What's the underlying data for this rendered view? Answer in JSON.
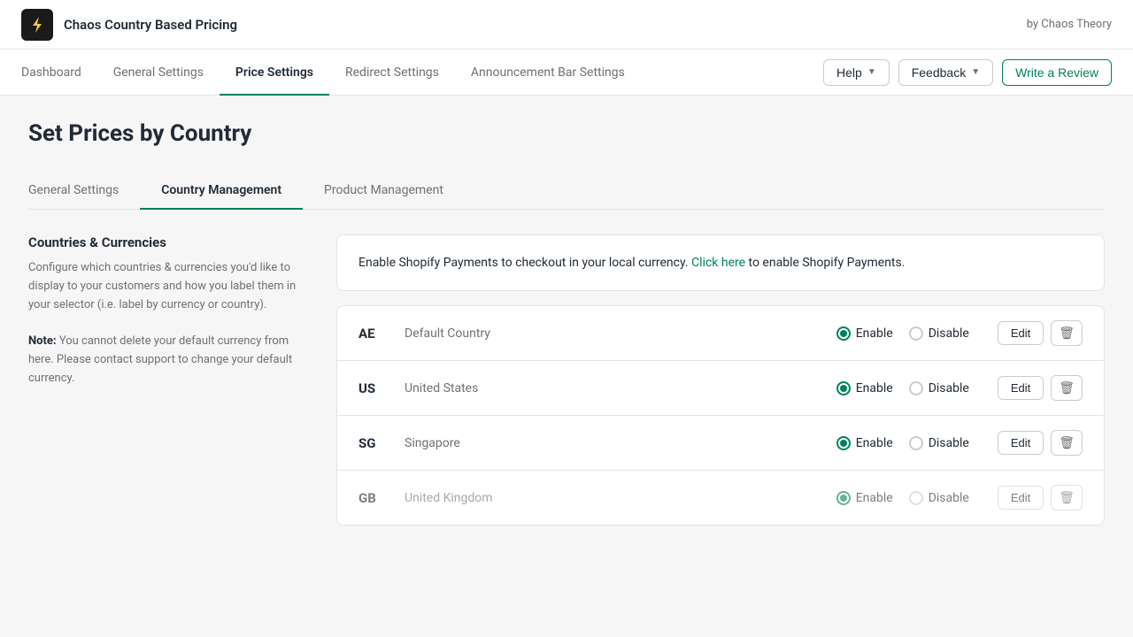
{
  "appBar": {
    "logo_alt": "Chaos Country Based Pricing logo",
    "title": "Chaos Country Based Pricing",
    "byline": "by Chaos Theory"
  },
  "nav": {
    "links": [
      {
        "id": "dashboard",
        "label": "Dashboard",
        "active": false
      },
      {
        "id": "general-settings",
        "label": "General Settings",
        "active": false
      },
      {
        "id": "price-settings",
        "label": "Price Settings",
        "active": true
      },
      {
        "id": "redirect-settings",
        "label": "Redirect Settings",
        "active": false
      },
      {
        "id": "announcement-bar-settings",
        "label": "Announcement Bar Settings",
        "active": false
      }
    ],
    "actions": {
      "help_label": "Help",
      "feedback_label": "Feedback",
      "review_label": "Write a Review"
    }
  },
  "page": {
    "title": "Set Prices by Country"
  },
  "tabs": [
    {
      "id": "general-settings",
      "label": "General Settings",
      "active": false
    },
    {
      "id": "country-management",
      "label": "Country Management",
      "active": true
    },
    {
      "id": "product-management",
      "label": "Product Management",
      "active": false
    }
  ],
  "leftPanel": {
    "title": "Countries & Currencies",
    "description": "Configure which countries & currencies you'd like to display to your customers and how you label them in your selector (i.e. label by currency or country).",
    "note_label": "Note:",
    "note_text": " You cannot delete your default currency from here. Please contact support to change your default currency."
  },
  "infoCard": {
    "text": "Enable Shopify Payments to checkout in your local currency. ",
    "link_label": "Click here",
    "link_text": " to enable Shopify Payments."
  },
  "countries": [
    {
      "code": "AE",
      "name": "Default Country",
      "enabled": true,
      "id": "ae"
    },
    {
      "code": "US",
      "name": "United States",
      "enabled": true,
      "id": "us"
    },
    {
      "code": "SG",
      "name": "Singapore",
      "enabled": true,
      "id": "sg"
    },
    {
      "code": "GB",
      "name": "United Kingdom",
      "enabled": true,
      "id": "gb"
    }
  ],
  "radioLabels": {
    "enable": "Enable",
    "disable": "Disable"
  },
  "buttonLabels": {
    "edit": "Edit"
  }
}
